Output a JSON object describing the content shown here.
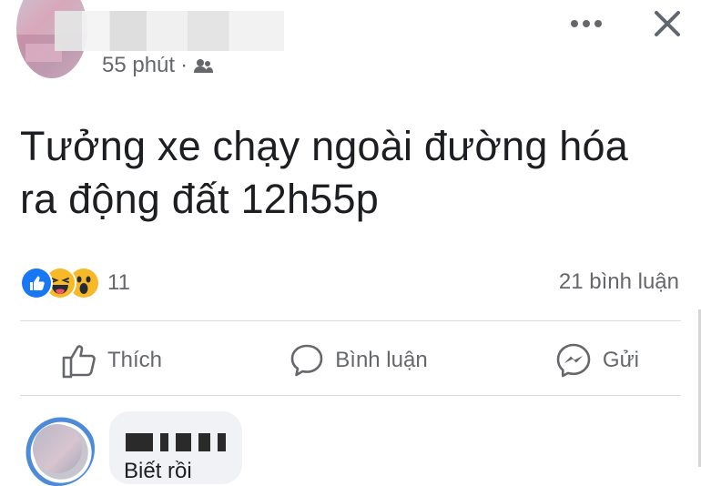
{
  "post_header": {
    "author_name": "",
    "timestamp": "55 phút",
    "separator": "·",
    "privacy_icon": "friends-icon",
    "more_icon": "more-horizontal-icon",
    "close_icon": "close-icon"
  },
  "post": {
    "text_line1": "Tưởng xe chạy ngoài đường hóa",
    "text_line2": "ra động đất 12h55p"
  },
  "stats": {
    "reactions": [
      "like-reaction-icon",
      "haha-reaction-icon",
      "wow-reaction-icon"
    ],
    "reaction_count": "11",
    "comment_count": "21 bình luận"
  },
  "actions": {
    "like_label": "Thích",
    "comment_label": "Bình luận",
    "send_label": "Gửi"
  },
  "comment_preview": {
    "author_name": "",
    "text": "Biết rồi"
  },
  "colors": {
    "text": "#1c1e21",
    "secondary_text": "#65676b",
    "divider": "#dadde1",
    "like_blue": "#1877f2",
    "reaction_yellow": "#f7b928",
    "comment_bubble": "#f0f2f5"
  }
}
